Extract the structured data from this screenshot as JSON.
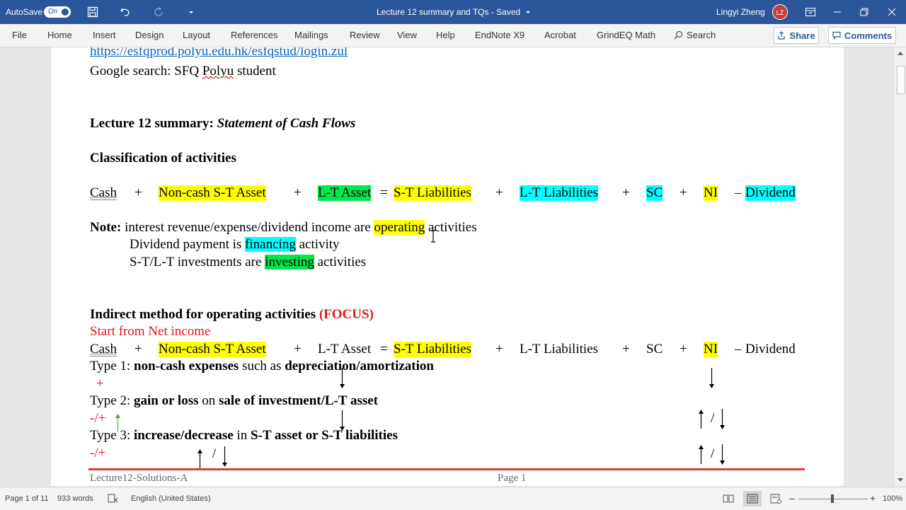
{
  "titlebar": {
    "autosave_label": "AutoSave",
    "autosave_state": "On",
    "document_title": "Lecture 12 summary and TQs  -  Saved",
    "user_name": "Lingyi Zheng",
    "user_initials": "LZ",
    "accent_color": "#2b579a"
  },
  "ribbon": {
    "tabs": [
      "File",
      "Home",
      "Insert",
      "Design",
      "Layout",
      "References",
      "Mailings",
      "Review",
      "View",
      "Help",
      "EndNote X9",
      "Acrobat",
      "GrindEQ Math"
    ],
    "search_label": "Search",
    "share_label": "Share",
    "comments_label": "Comments"
  },
  "document": {
    "link": "https://esfqprod.polyu.edu.hk/esfqstud/login.zul",
    "google_prefix": "Google search: SFQ ",
    "google_misspelled": "Polyu",
    "google_suffix": " student",
    "summary_title_bold": "Lecture 12 summary: ",
    "summary_title_italic": "Statement of Cash Flows",
    "classification_heading": "Classification of activities",
    "equation": {
      "cash": "Cash",
      "plus": "+",
      "equals": "=",
      "minus": "–",
      "noncash": "Non-cash S-T Asset",
      "lt_asset": "L-T Asset",
      "st_liab": "S-T Liabilities",
      "lt_liab": "L-T Liabilities",
      "sc": "SC",
      "ni": "NI",
      "dividend": "Dividend"
    },
    "note": {
      "label": "Note:",
      "l1_pre": " interest revenue/expense/dividend income are ",
      "l1_hl": "operating",
      "l1_post": " activities",
      "l2_pre": "Dividend payment is ",
      "l2_hl": "financing",
      "l2_post": " activity",
      "l3_pre": "S-T/L-T investments are ",
      "l3_hl": "investing",
      "l3_post": " activities"
    },
    "indirect_heading": "Indirect method for operating activities ",
    "focus": "(FOCUS)",
    "start_from": "Start from Net income",
    "type1_label": "Type 1: ",
    "type1_b1": "non-cash expenses",
    "type1_mid": " such as ",
    "type1_b2": "depreciation/amortization",
    "type1_sign": "+",
    "type2_label": "Type 2: ",
    "type2_b1": "gain or loss",
    "type2_mid": " on ",
    "type2_b2": "sale of investment/L-T asset",
    "type2_sign": "-/+",
    "type3_label": "Type 3: ",
    "type3_b1": "increase/decrease",
    "type3_mid": " in ",
    "type3_b2": "S-T asset or S-T liabilities",
    "type3_sign": "-/+",
    "slash": "/",
    "footer_left": "Lecture12-Solutions-A",
    "footer_right": "Page  1"
  },
  "statusbar": {
    "page_info": "Page 1 of 11",
    "word_count": "933 words",
    "language": "English (United States)",
    "zoom": "100%"
  }
}
